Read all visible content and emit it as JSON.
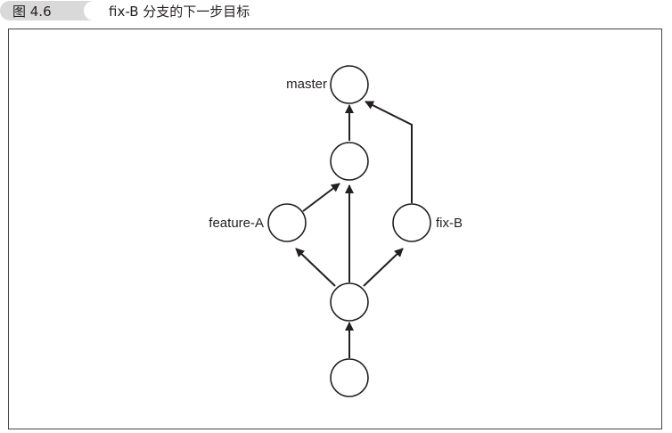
{
  "caption": {
    "figure_number": "图 4.6",
    "title": "fix-B 分支的下一步目标"
  },
  "diagram": {
    "branch_labels": {
      "master": "master",
      "feature_a": "feature-A",
      "fix_b": "fix-B"
    }
  }
}
